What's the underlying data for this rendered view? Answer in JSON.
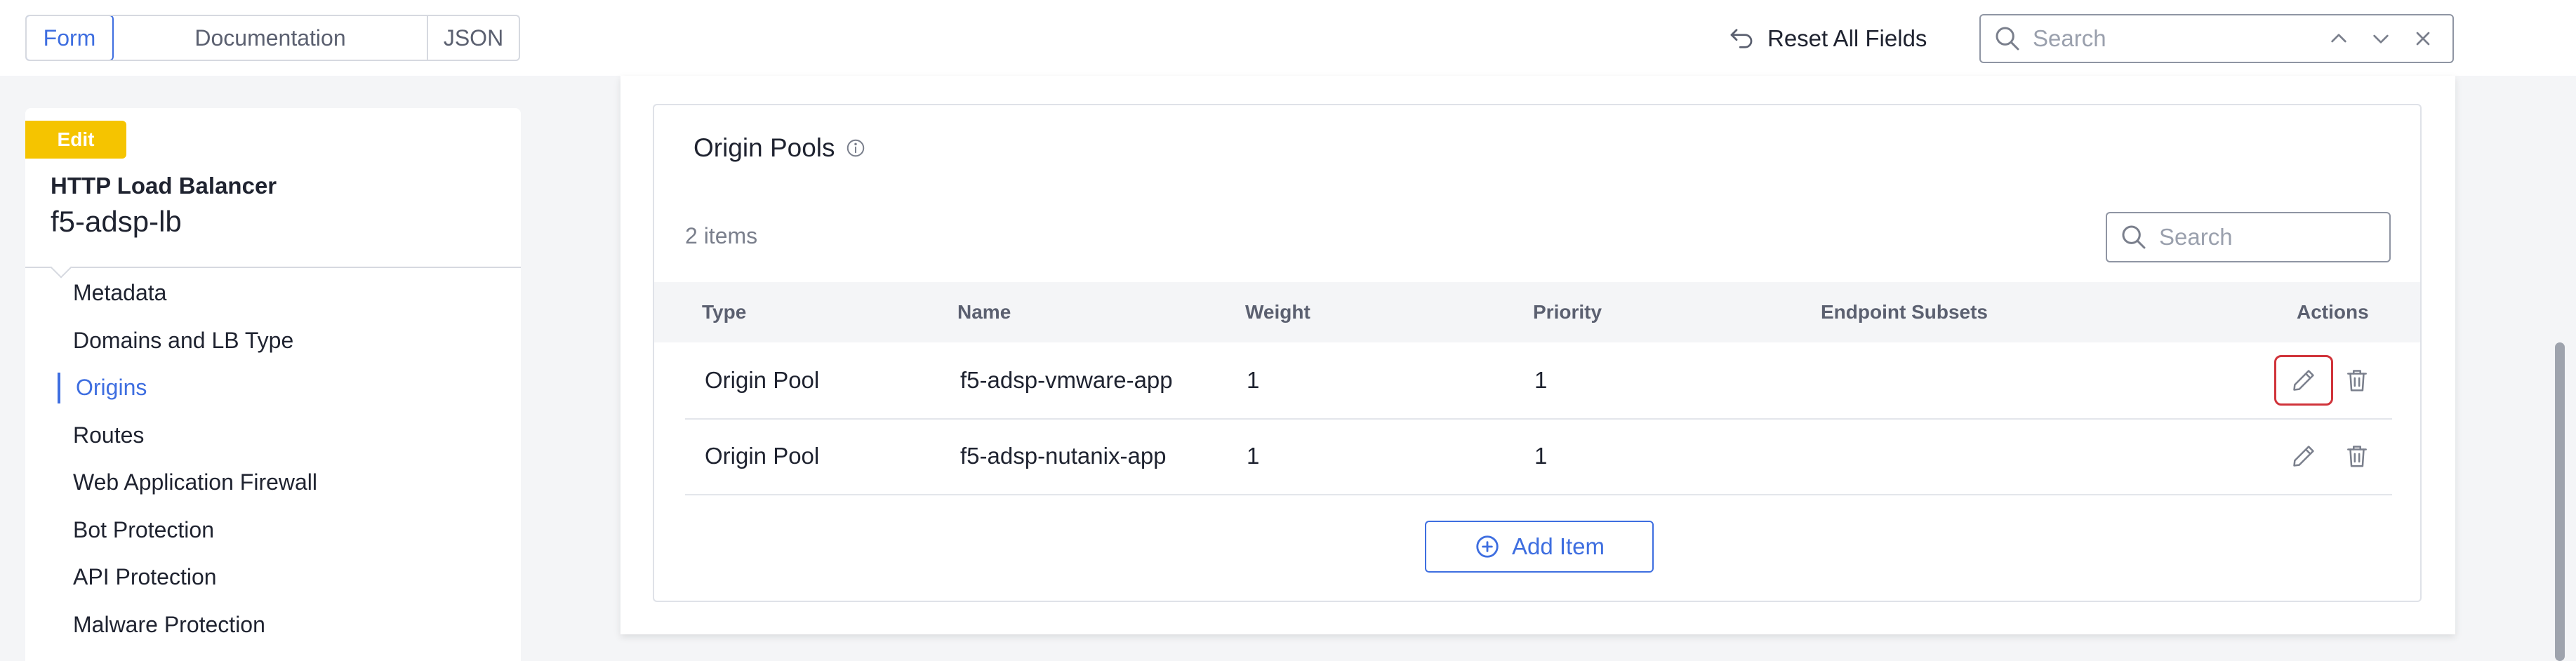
{
  "topbar": {
    "view_tabs": [
      {
        "label": "Form",
        "active": true
      },
      {
        "label": "Documentation",
        "active": false
      },
      {
        "label": "JSON",
        "active": false
      }
    ],
    "reset_label": "Reset All Fields",
    "search_placeholder": "Search",
    "accent_color": "#3e6ee0"
  },
  "sidebar": {
    "badge": "Edit",
    "badge_color": "#f5c400",
    "object_type": "HTTP Load Balancer",
    "object_name": "f5-adsp-lb",
    "items": [
      {
        "label": "Metadata"
      },
      {
        "label": "Domains and LB Type"
      },
      {
        "label": "Origins",
        "active": true
      },
      {
        "label": "Routes"
      },
      {
        "label": "Web Application Firewall"
      },
      {
        "label": "Bot Protection"
      },
      {
        "label": "API Protection"
      },
      {
        "label": "Malware Protection"
      }
    ]
  },
  "origin_pools": {
    "title": "Origin Pools",
    "count_text": "2 items",
    "search_placeholder": "Search",
    "columns": [
      "Type",
      "Name",
      "Weight",
      "Priority",
      "Endpoint Subsets",
      "Actions"
    ],
    "rows": [
      {
        "type": "Origin Pool",
        "name": "f5-adsp-vmware-app",
        "weight": "1",
        "priority": "1",
        "endpoint_subsets": ""
      },
      {
        "type": "Origin Pool",
        "name": "f5-adsp-nutanix-app",
        "weight": "1",
        "priority": "1",
        "endpoint_subsets": ""
      }
    ],
    "add_label": "Add Item",
    "focus_outline_color": "#d0333a"
  }
}
